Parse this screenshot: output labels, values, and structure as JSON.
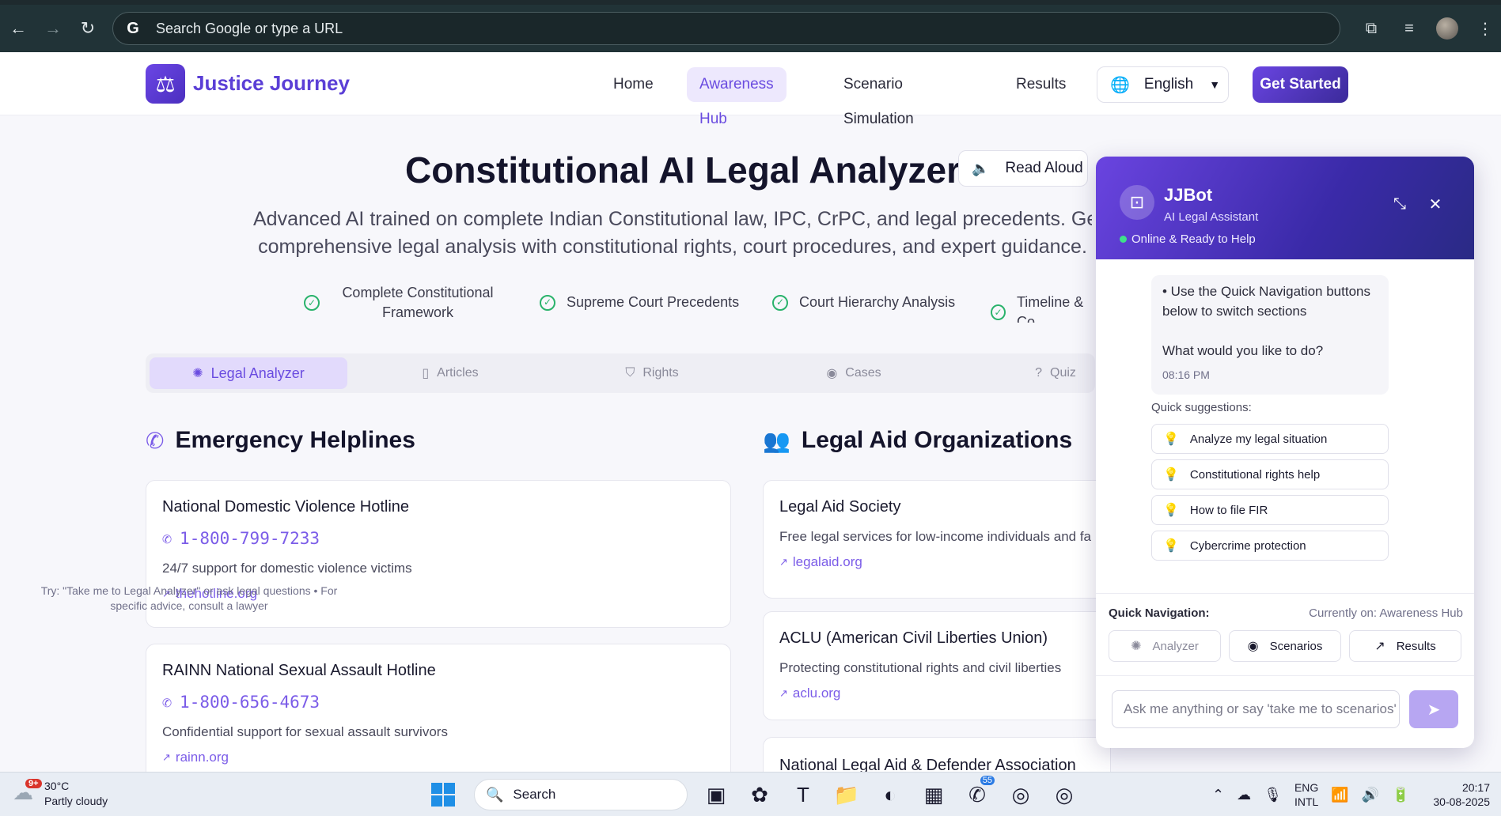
{
  "browser": {
    "omnibox_placeholder": "Search Google or type a URL",
    "back_icon": "arrow-left-icon",
    "forward_icon": "arrow-right-icon",
    "reload_icon": "reload-icon"
  },
  "header": {
    "brand": "Justice Journey",
    "nav": [
      {
        "label": "Home"
      },
      {
        "label": "Awareness Hub",
        "active": true
      },
      {
        "label": "Scenario Simulation"
      },
      {
        "label": "Results"
      }
    ],
    "language": "English",
    "cta": "Get Started"
  },
  "hero": {
    "title": "Constitutional AI Legal Analyzer",
    "read_aloud": "Read Aloud",
    "subtitle_line1": "Advanced AI trained on complete Indian Constitutional law, IPC, CrPC, and legal precedents. Ge",
    "subtitle_line2": "comprehensive legal analysis with constitutional rights, court procedures, and expert guidance.",
    "features": [
      "Complete Constitutional Framework",
      "Supreme Court Precedents",
      "Court Hierarchy Analysis",
      "Timeline & Co"
    ]
  },
  "tabs": [
    {
      "label": "Legal Analyzer",
      "icon": "brain-icon",
      "active": true
    },
    {
      "label": "Articles",
      "icon": "book-icon"
    },
    {
      "label": "Rights",
      "icon": "shield-icon"
    },
    {
      "label": "Cases",
      "icon": "eye-icon"
    },
    {
      "label": "Quiz",
      "icon": "help-circle-icon"
    }
  ],
  "helplines": {
    "title": "Emergency Helplines",
    "items": [
      {
        "name": "National Domestic Violence Hotline",
        "phone": "1-800-799-7233",
        "desc": "24/7 support for domestic violence victims",
        "link": "thehotline.org"
      },
      {
        "name": "RAINN National Sexual Assault Hotline",
        "phone": "1-800-656-4673",
        "desc": "Confidential support for sexual assault survivors",
        "link": "rainn.org"
      }
    ]
  },
  "legal_aid": {
    "title": "Legal Aid Organizations",
    "items": [
      {
        "name": "Legal Aid Society",
        "desc": "Free legal services for low-income individuals and fa",
        "link": "legalaid.org"
      },
      {
        "name": "ACLU (American Civil Liberties Union)",
        "desc": "Protecting constitutional rights and civil liberties",
        "link": "aclu.org"
      },
      {
        "name": "National Legal Aid & Defender Association"
      }
    ]
  },
  "chat": {
    "bot_name": "JJBot",
    "bot_role": "AI Legal Assistant",
    "status": "Online & Ready to Help",
    "message_line1": "• Use the Quick Navigation buttons below to switch sections",
    "message_line2": "What would you like to do?",
    "message_time": "08:16 PM",
    "suggestions_label": "Quick suggestions:",
    "suggestions": [
      "Analyze my legal situation",
      "Constitutional rights help",
      "How to file FIR",
      "Cybercrime protection"
    ],
    "quick_nav_label": "Quick Navigation:",
    "currently_on": "Currently on: Awareness Hub",
    "quick_nav": [
      "Analyzer",
      "Scenarios",
      "Results"
    ],
    "input_placeholder": "Ask me anything or say 'take me to scenarios'",
    "hint": "Try: \"Take me to Legal Analyzer\" or ask legal questions • For specific advice, consult a lawyer"
  },
  "taskbar": {
    "weather_badge": "9+",
    "temp": "30°C",
    "weather": "Partly cloudy",
    "search": "Search",
    "whatsapp_badge": "55",
    "lang_line1": "ENG",
    "lang_line2": "INTL",
    "time": "20:17",
    "date": "30-08-2025"
  }
}
